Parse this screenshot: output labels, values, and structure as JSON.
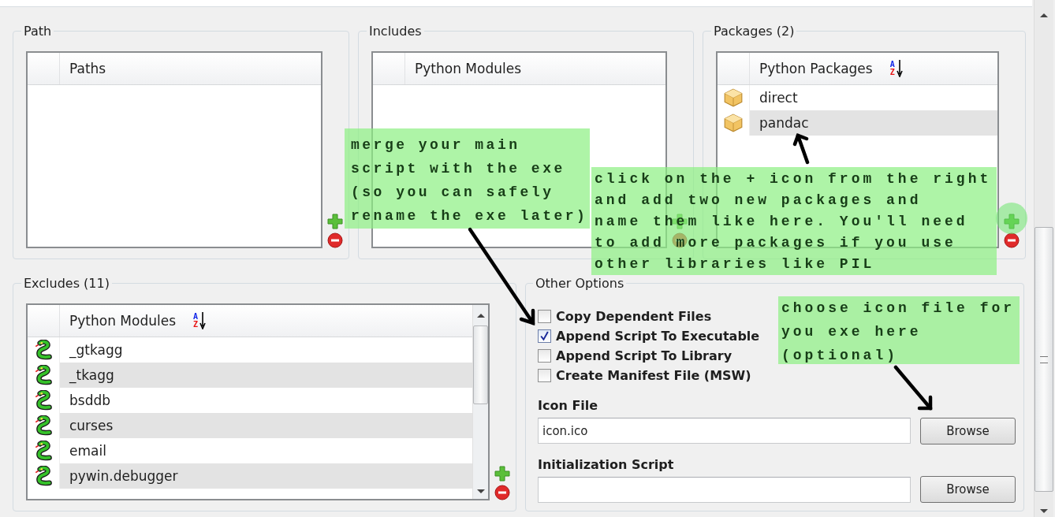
{
  "path": {
    "title": "Path",
    "column": "Paths"
  },
  "includes": {
    "title": "Includes",
    "column": "Python Modules"
  },
  "packages": {
    "title": "Packages (2)",
    "column": "Python Packages",
    "sort": [
      "A",
      "Z"
    ],
    "rows": [
      "direct",
      "pandac"
    ]
  },
  "excludes": {
    "title": "Excludes (11)",
    "column": "Python Modules",
    "sort": [
      "A",
      "Z"
    ],
    "rows": [
      "_gtkagg",
      "_tkagg",
      "bsddb",
      "curses",
      "email",
      "pywin.debugger"
    ]
  },
  "other_options": {
    "title": "Other Options",
    "options": [
      {
        "label": "Copy Dependent Files",
        "checked": false
      },
      {
        "label": "Append Script To Executable",
        "checked": true
      },
      {
        "label": "Append Script To Library",
        "checked": false
      },
      {
        "label": "Create Manifest File (MSW)",
        "checked": false
      }
    ],
    "icon_file": {
      "label": "Icon File",
      "value": "icon.ico",
      "button": "Browse"
    },
    "init_script": {
      "label": "Initialization Script",
      "button": "Browse"
    }
  },
  "annotations": [
    "merge your main\nscript with the exe\n(so you can safely\nrename the exe later)",
    "click on the + icon from the right\nand add two new packages and\nname them like here. You'll need\nto add more packages if you use\nother libraries like PIL",
    "choose icon file for\nyou exe here\n(optional)"
  ]
}
